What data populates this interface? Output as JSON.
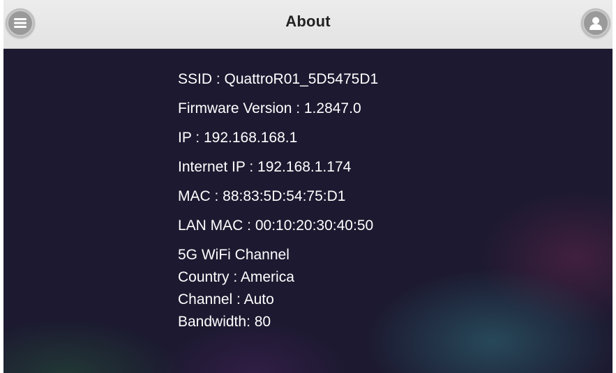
{
  "header": {
    "title": "About",
    "menu_icon": "menu-icon",
    "user_icon": "user-icon"
  },
  "info": {
    "ssid": "SSID : QuattroR01_5D5475D1",
    "firmware": "Firmware Version : 1.2847.0",
    "ip": "IP : 192.168.168.1",
    "internet_ip": "Internet IP : 192.168.1.174",
    "mac": "MAC : 88:83:5D:54:75:D1",
    "lan_mac": "LAN MAC : 00:10:20:30:40:50"
  },
  "wifi": {
    "heading": "5G WiFi Channel",
    "country": "Country : America",
    "channel": "Channel : Auto",
    "bandwidth": "Bandwidth: 80"
  },
  "colors": {
    "header_bg": "#e6e6e6",
    "content_bg": "#1c1930",
    "text": "#ffffff"
  }
}
